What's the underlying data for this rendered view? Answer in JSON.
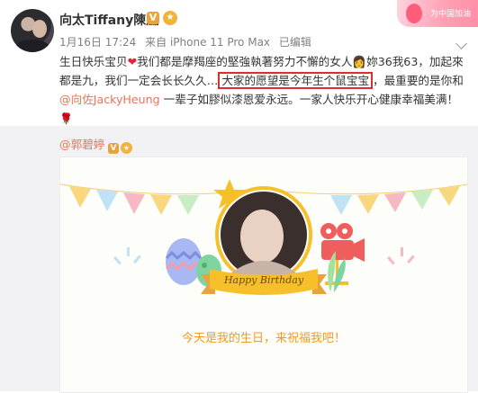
{
  "post": {
    "author": "向太Tiffany陳嵐",
    "time": "1月16日 17:24",
    "source": "来自 iPhone 11 Pro Max",
    "edited": "已编辑",
    "corner_badge": "为中国加油",
    "text_parts": {
      "p1": "生日快乐宝贝",
      "p2": "我们都是摩羯座的堅強執著努力不懈的女人",
      "p3": "妳36我63，加起來都是九，我们一定会长长久久…",
      "highlight": "大家的愿望是今年生个鼠宝宝",
      "p4": "，最重要的是你和",
      "mention": "@向佐JackyHeung",
      "p5": " 一辈子如膠似漆恩爱永远。一家人快乐开心健康幸福美满！"
    }
  },
  "repost": {
    "author": "@郭碧婷",
    "card_banner": "Happy Birthday",
    "card_caption": "今天是我的生日，来祝福我吧！"
  },
  "colors": {
    "accent_orange": "#eb7350",
    "highlight_red": "#e02c2c",
    "banner_yellow": "#f7c02a",
    "caption_orange": "#f29a22"
  },
  "icons": [
    "vip-badge-icon",
    "medal-icon",
    "heart-icon",
    "avatar-emoji-icon",
    "rose-icon",
    "chevron-down-icon"
  ]
}
